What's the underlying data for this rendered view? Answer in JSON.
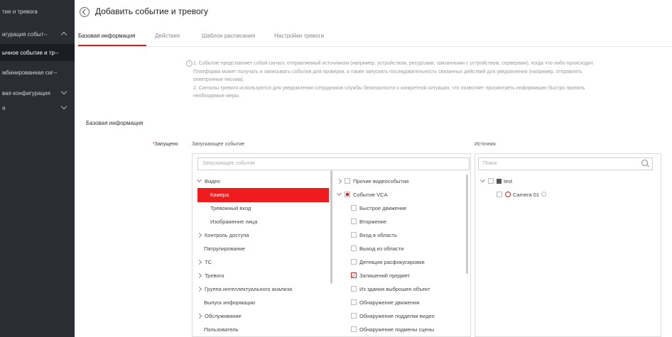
{
  "sidebar": {
    "items": [
      {
        "label": "тие и тревога"
      },
      {
        "label": "игурация событ--"
      },
      {
        "label": "ычное событие и тр--"
      },
      {
        "label": "мбинированная сиг--"
      },
      {
        "label": "вая конфигурация"
      },
      {
        "label": "я"
      }
    ]
  },
  "header": {
    "title": "Добавить событие и тревогу"
  },
  "tabs": [
    {
      "label": "Базовая информация"
    },
    {
      "label": "Действия"
    },
    {
      "label": "Шаблон расписания"
    },
    {
      "label": "Настройки тревоги"
    }
  ],
  "info": {
    "line1": "1. Событие представляет собой сигнал, отправляемый источником (например, устройством, ресурсами, связанными с устройством, серверами), когда что-либо происходит.",
    "line2": "Платформа может получать и записывать события для проверки, а также запускать последовательность связанных действий для уведомления (например, отправлять",
    "line3": "электронные письма).",
    "line4": "2. Сигналы тревоги используются для уведомления сотрудников службы безопасности о конкретной ситуации, что позволяет просмотреть информацию быстро принять",
    "line5": "необходимые меры."
  },
  "section": {
    "title": "Базовая информация"
  },
  "form": {
    "trigger_label": "Запущено",
    "event_column": "Запускающее событие",
    "source_column": "Источник",
    "event_search_placeholder": "Запускающее событие",
    "source_search_placeholder": "Поиск"
  },
  "event_tree_left": [
    {
      "label": "Видео"
    },
    {
      "label": "Камера"
    },
    {
      "label": "Тревожный вход"
    },
    {
      "label": "Изображение лица"
    },
    {
      "label": "Контроль доступа"
    },
    {
      "label": "Патрулирование"
    },
    {
      "label": "ТС"
    },
    {
      "label": "Тревога"
    },
    {
      "label": "Группа интеллектуального анализа"
    },
    {
      "label": "Выпуск информации"
    },
    {
      "label": "Обслуживание"
    },
    {
      "label": "Пользователь"
    }
  ],
  "event_tree_right": [
    {
      "label": "Прочие видеособытия"
    },
    {
      "label": "Событие VCA"
    },
    {
      "label": "Быстрое движение"
    },
    {
      "label": "Вторжение"
    },
    {
      "label": "Вход в область"
    },
    {
      "label": "Выход из области"
    },
    {
      "label": "Детекция расфокусировки"
    },
    {
      "label": "Залишений предмет"
    },
    {
      "label": "Из здания выброшен объект"
    },
    {
      "label": "Обнаружение движения"
    },
    {
      "label": "Обнаружение подделки видео"
    },
    {
      "label": "Обнаружение подмены сцены"
    }
  ],
  "source_tree": [
    {
      "label": "test"
    },
    {
      "label": "Camera 01"
    }
  ],
  "colors": {
    "accent": "#e02020",
    "sidebar_bg": "#2b2d33"
  }
}
